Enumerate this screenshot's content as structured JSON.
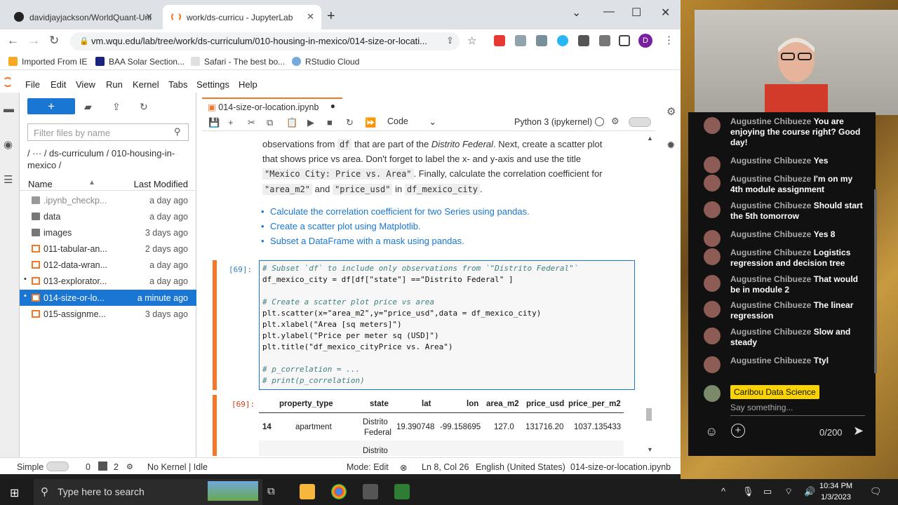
{
  "browser": {
    "tabs": [
      {
        "label": "davidjayjackson/WorldQuant-Uni"
      },
      {
        "label": "work/ds-curricu - JupyterLab"
      }
    ],
    "url": "vm.wqu.edu/lab/tree/work/ds-curriculum/010-housing-in-mexico/014-size-or-locati...",
    "avatar": "D",
    "bookmarks": [
      "Imported From IE",
      "BAA Solar Section...",
      "Safari - The best bo...",
      "RStudio Cloud"
    ]
  },
  "menu": [
    "File",
    "Edit",
    "View",
    "Run",
    "Kernel",
    "Tabs",
    "Settings",
    "Help"
  ],
  "filebrowser": {
    "filter_placeholder": "Filter files by name",
    "breadcrumb": "/ ··· / ds-curriculum / 010-housing-in-mexico /",
    "col_name": "Name",
    "col_modified": "Last Modified",
    "files": [
      {
        "name": ".ipynb_checkp...",
        "time": "a day ago"
      },
      {
        "name": "data",
        "time": "a day ago"
      },
      {
        "name": "images",
        "time": "3 days ago"
      },
      {
        "name": "011-tabular-an...",
        "time": "2 days ago"
      },
      {
        "name": "012-data-wran...",
        "time": "a day ago"
      },
      {
        "name": "013-explorator...",
        "time": "a day ago"
      },
      {
        "name": "014-size-or-lo...",
        "time": "a minute ago"
      },
      {
        "name": "015-assignme...",
        "time": "3 days ago"
      }
    ]
  },
  "notebook": {
    "tab": "014-size-or-location.ipynb",
    "celltype": "Code",
    "kernel": "Python 3 (ipykernel)",
    "md_line1_a": "observations from",
    "md_line1_code": "df",
    "md_line1_b": "that are part of the",
    "md_line1_em": "Distrito Federal",
    "md_line1_c": ". Next, create a scatter plot",
    "md_line2": "that shows price vs area. Don't forget to label the x- and y-axis and use the title",
    "md_line3_code": "\"Mexico City: Price vs. Area\"",
    "md_line3_b": ". Finally, calculate the correlation coefficient for",
    "md_line4_code1": "\"area_m2\"",
    "md_line4_and": "and",
    "md_line4_code2": "\"price_usd\"",
    "md_line4_in": "in",
    "md_line4_code3": "df_mexico_city",
    "md_line4_end": ".",
    "links": [
      "Calculate the correlation coefficient for two Series using pandas.",
      "Create a scatter plot using Matplotlib.",
      "Subset a DataFrame with a mask using pandas."
    ],
    "in_prompt": "[69]:",
    "code": [
      "# Subset `df` to include only observations from `\"Distrito Federal\"`",
      "df_mexico_city = df[df[\"state\"] ==\"Distrito Federal\" ]",
      "",
      "# Create a scatter plot price vs area",
      "plt.scatter(x=\"area_m2\",y=\"price_usd\",data = df_mexico_city)",
      "plt.xlabel(\"Area [sq meters]\")",
      "plt.ylabel(\"Price per meter sq (USD]\")",
      "plt.title(\"df_mexico_cityPrice vs. Area\")",
      "",
      "# p_correlation = ...",
      "# print(p_correlation)"
    ],
    "out_prompt": "[69]:",
    "table_headers": [
      "property_type",
      "state",
      "lat",
      "lon",
      "area_m2",
      "price_usd",
      "price_per_m2"
    ],
    "table_row": {
      "index": "14",
      "property_type": "apartment",
      "state_1": "Distrito",
      "state_2": "Federal",
      "lat": "19.390748",
      "lon": "-99.158695",
      "area_m2": "127.0",
      "price_usd": "131716.20",
      "price_per_m2": "1037.135433"
    },
    "next_row_state": "Distrito"
  },
  "status": {
    "mode": "Simple",
    "n0": "0",
    "n2": "2",
    "kernel": "No Kernel | Idle",
    "edit": "Mode: Edit",
    "pos": "Ln 8, Col 26",
    "lang": "English (United States)",
    "file": "014-size-or-location.ipynb"
  },
  "taskbar": {
    "search": "Type here to search",
    "time": "10:34 PM",
    "date": "1/3/2023"
  },
  "chat": {
    "messages": [
      {
        "who": "Augustine Chibueze",
        "text": "You are enjoying the course right? Good day!"
      },
      {
        "who": "Augustine Chibueze",
        "text": "Yes"
      },
      {
        "who": "Augustine Chibueze",
        "text": "I'm on my 4th module assignment"
      },
      {
        "who": "Augustine Chibueze",
        "text": "Should start the 5th tomorrow"
      },
      {
        "who": "Augustine Chibueze",
        "text": "Yes 8"
      },
      {
        "who": "Augustine Chibueze",
        "text": "Logistics regression and decision tree"
      },
      {
        "who": "Augustine Chibueze",
        "text": "That would be in module 2"
      },
      {
        "who": "Augustine Chibueze",
        "text": "The linear regression"
      },
      {
        "who": "Augustine Chibueze",
        "text": "Slow and steady"
      },
      {
        "who": "Augustine Chibueze",
        "text": "Ttyl"
      }
    ],
    "channel": "Caribou Data Science",
    "placeholder": "Say something...",
    "counter": "0/200"
  }
}
